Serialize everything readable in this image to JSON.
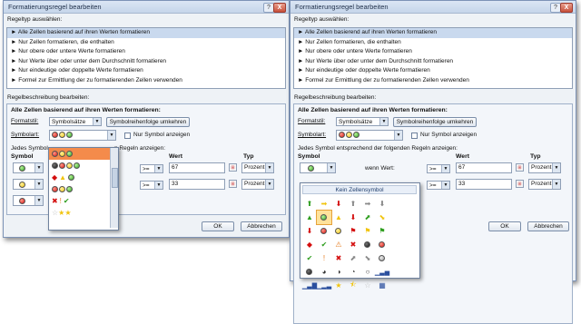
{
  "title": "Formatierungsregel bearbeiten",
  "help_label": "?",
  "close_label": "X",
  "ruletype_label": "Regeltyp auswählen:",
  "ruletypes": [
    "► Alle Zellen basierend auf ihren Werten formatieren",
    "► Nur Zellen formatieren, die enthalten",
    "► Nur obere oder untere Werte formatieren",
    "► Nur Werte über oder unter dem Durchschnitt formatieren",
    "► Nur eindeutige oder doppelte Werte formatieren",
    "► Formel zur Ermittlung der zu formatierenden Zellen verwenden"
  ],
  "desc_label": "Regelbeschreibung bearbeiten:",
  "desc_heading": "Alle Zellen basierend auf ihren Werten formatieren:",
  "formatstil_label": "Formatstil:",
  "formatstil_value": "Symbolsätze",
  "reverse_button": "Symbolreihenfolge umkehren",
  "symbolart_label": "Symbolart:",
  "only_symbol_label": "Nur Symbol anzeigen",
  "rules_text_left": "Jedes Symbol",
  "rules_text_left_tail": "n Regeln anzeigen:",
  "rules_text_right": "Jedes Symbol entsprechend der folgenden Regeln anzeigen:",
  "col_symbol": "Symbol",
  "col_wert": "Wert",
  "col_typ": "Typ",
  "wenn_wert": "wenn Wert:",
  "op_value": ">=",
  "rows": [
    {
      "value": "67",
      "type": "Prozent"
    },
    {
      "value": "33",
      "type": "Prozent"
    }
  ],
  "ok": "OK",
  "cancel": "Abbrechen",
  "kein_symbol": "Kein Zellensymbol",
  "colors": {
    "accent": "#f48b4b",
    "title_bg": "#c5d5ea"
  }
}
